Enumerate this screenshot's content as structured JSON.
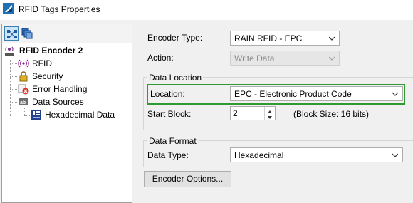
{
  "window": {
    "title": "RFID Tags Properties"
  },
  "tree": {
    "root": "RFID Encoder 2",
    "items": [
      {
        "label": "RFID",
        "icon": "rfid-waves-icon",
        "selected": true
      },
      {
        "label": "Security",
        "icon": "lock-icon"
      },
      {
        "label": "Error Handling",
        "icon": "error-icon"
      },
      {
        "label": "Data Sources",
        "icon": "data-sources-icon"
      },
      {
        "label": "Hexadecimal Data",
        "icon": "hex-data-icon"
      }
    ]
  },
  "form": {
    "encoder_type": {
      "label": "Encoder Type:",
      "value": "RAIN RFID - EPC"
    },
    "action": {
      "label": "Action:",
      "value": "Write Data",
      "disabled": true
    },
    "data_location": {
      "group_title": "Data Location",
      "location": {
        "label": "Location:",
        "value": "EPC - Electronic Product Code"
      },
      "start_block": {
        "label": "Start Block:",
        "value": "2",
        "note": "(Block Size:  16 bits)"
      }
    },
    "data_format": {
      "group_title": "Data Format",
      "data_type": {
        "label": "Data Type:",
        "value": "Hexadecimal"
      }
    },
    "encoder_options_button": "Encoder Options..."
  },
  "colors": {
    "highlight": "#2f9a2f",
    "accent": "#3c7fb1"
  }
}
